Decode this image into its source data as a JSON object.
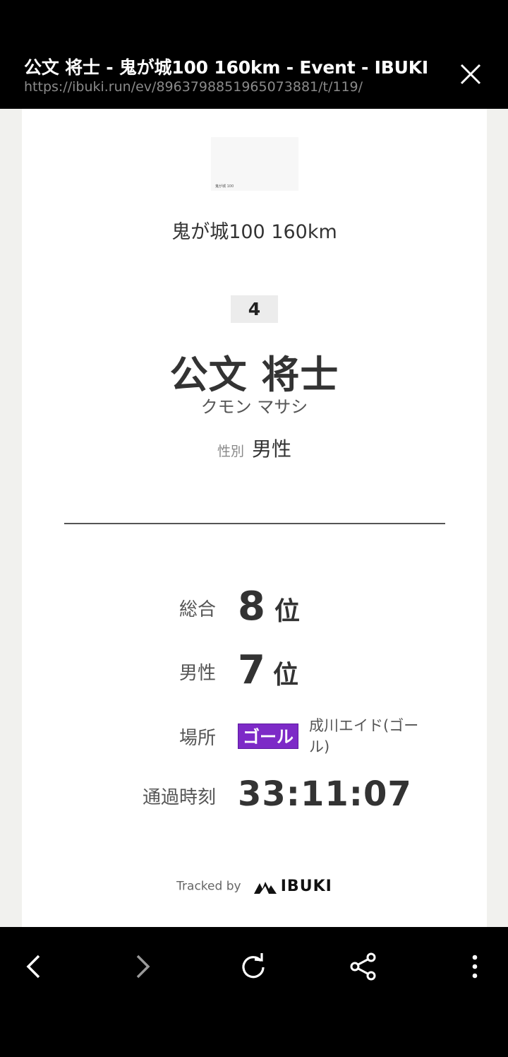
{
  "browser": {
    "title": "公文 将士 - 鬼が城100 160km - Event - IBUKI",
    "url": "https://ibuki.run/ev/8963798851965073881/t/119/"
  },
  "result": {
    "thumbnail_caption": "鬼が城 100",
    "event_name": "鬼が城100 160km",
    "bib": "4",
    "runner_name": "公文 将士",
    "runner_kana": "クモン マサシ",
    "gender_label": "性別",
    "gender_value": "男性",
    "overall_label": "総合",
    "overall_rank": "8",
    "rank_unit": "位",
    "gender_rank_label": "男性",
    "gender_rank": "7",
    "place_label": "場所",
    "place_badge": "ゴール",
    "place_name": "成川エイド(ゴール)",
    "time_label": "通過時刻",
    "time_value": "33:11:07",
    "tracked_by": "Tracked by",
    "brand": "IBUKI"
  },
  "colors": {
    "goal_badge": "#7d2ac7"
  },
  "icons": [
    "close-icon",
    "back-icon",
    "forward-icon",
    "reload-icon",
    "share-icon",
    "more-icon"
  ]
}
